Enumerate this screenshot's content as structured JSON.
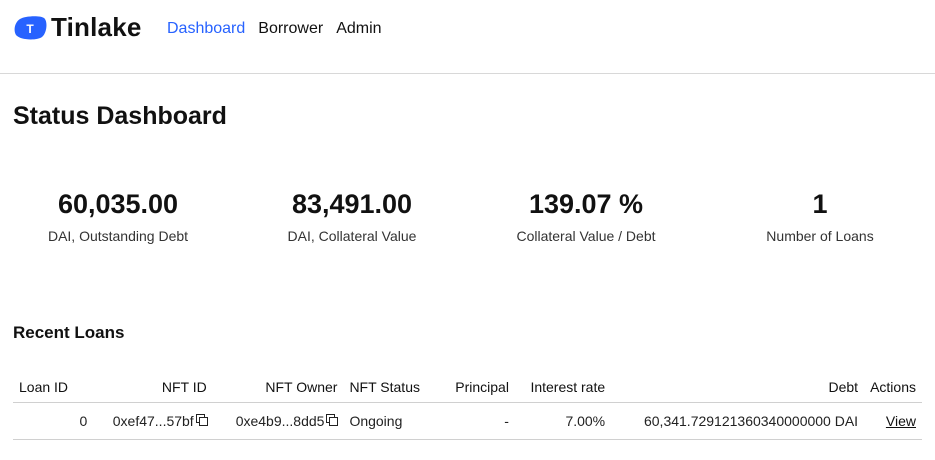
{
  "header": {
    "logo_text": "Tinlake",
    "logo_letter": "T",
    "nav": [
      {
        "label": "Dashboard",
        "active": true
      },
      {
        "label": "Borrower",
        "active": false
      },
      {
        "label": "Admin",
        "active": false
      }
    ]
  },
  "colors": {
    "accent": "#2762ff",
    "logo": "#2762ff"
  },
  "page_title": "Status Dashboard",
  "stats": [
    {
      "value": "60,035.00",
      "label": "DAI, Outstanding Debt"
    },
    {
      "value": "83,491.00",
      "label": "DAI, Collateral Value"
    },
    {
      "value": "139.07 %",
      "label": "Collateral Value / Debt"
    },
    {
      "value": "1",
      "label": "Number of Loans"
    }
  ],
  "recent_loans": {
    "title": "Recent Loans",
    "columns": [
      "Loan ID",
      "NFT ID",
      "NFT Owner",
      "NFT Status",
      "Principal",
      "Interest rate",
      "Debt",
      "Actions"
    ],
    "rows": [
      {
        "loan_id": "0",
        "nft_id": "0xef47...57bf",
        "nft_owner": "0xe4b9...8dd5",
        "nft_status": "Ongoing",
        "principal": "-",
        "interest_rate": "7.00%",
        "debt": "60,341.729121360340000000 DAI",
        "action": "View"
      }
    ]
  }
}
